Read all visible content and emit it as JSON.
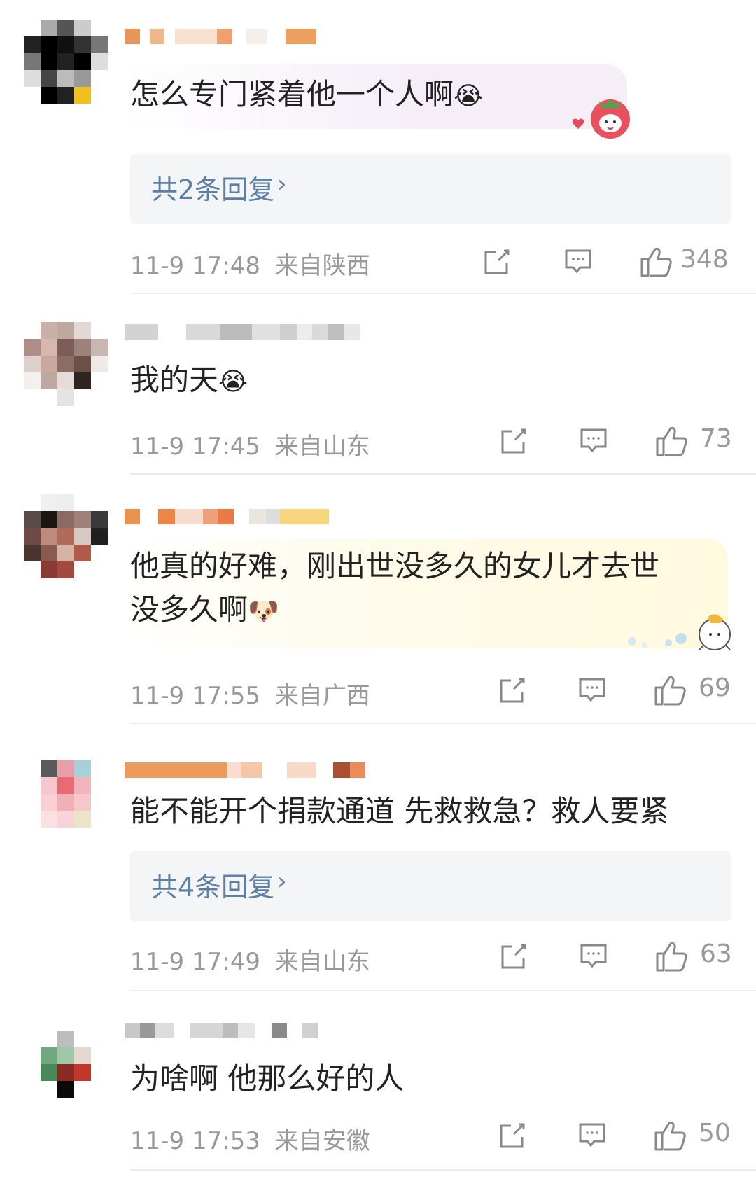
{
  "comments": [
    {
      "text": "怎么专门紧着他一个人啊",
      "emoji": "😭",
      "replies_label": "共2条回复",
      "chevron": "›",
      "time": "11-9 17:48",
      "location": "来自陕西",
      "likes": "348"
    },
    {
      "text": "我的天",
      "emoji": "😭",
      "time": "11-9 17:45",
      "location": "来自山东",
      "likes": "73"
    },
    {
      "text_line1": "他真的好难，刚出世没多久的女儿才去世",
      "text_line2": "没多久啊",
      "emoji": "🐶",
      "time": "11-9 17:55",
      "location": "来自广西",
      "likes": "69"
    },
    {
      "text": "能不能开个捐款通道 先救救急？救人要紧",
      "replies_label": "共4条回复",
      "chevron": "›",
      "time": "11-9 17:49",
      "location": "来自山东",
      "likes": "63"
    },
    {
      "text": "为啥啊 他那么好的人",
      "time": "11-9 17:53",
      "location": "来自安徽",
      "likes": "50"
    }
  ],
  "icons": {
    "share": "share-icon",
    "comment": "comment-icon",
    "like": "thumbs-up-icon"
  },
  "colors": {
    "link": "#5b7fa6",
    "meta": "#999999",
    "reply_bg": "#f4f5f7"
  }
}
